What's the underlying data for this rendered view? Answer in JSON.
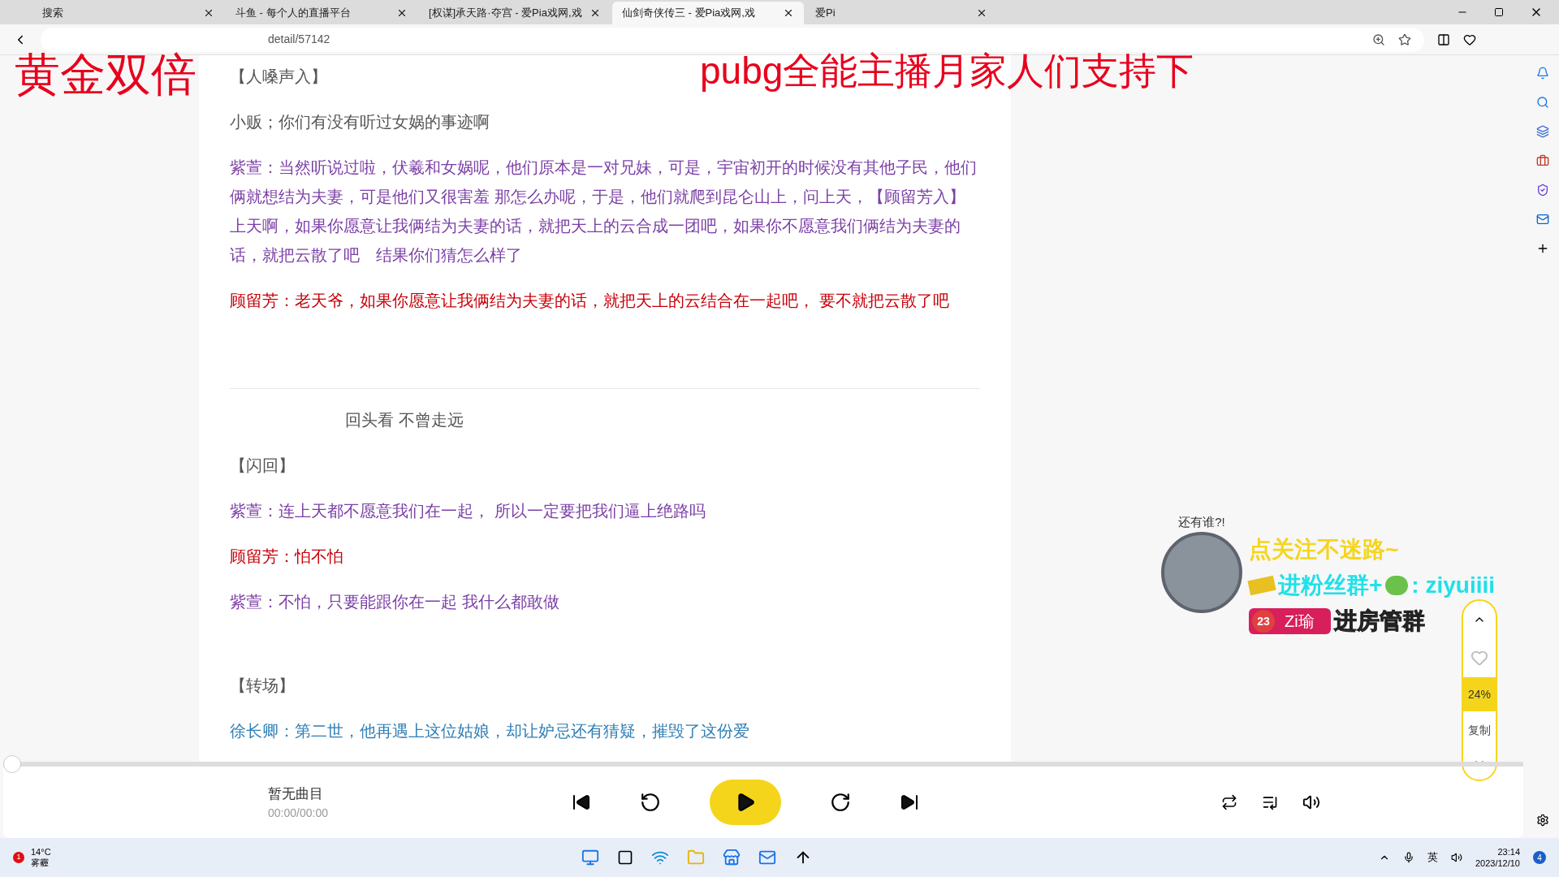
{
  "browser": {
    "tabs": [
      {
        "title": "搜索",
        "selected": false
      },
      {
        "title": "斗鱼 - 每个人的直播平台",
        "selected": false
      },
      {
        "title": "[权谋]承天路·夺宫 - 爱Pia戏网,戏",
        "selected": false
      },
      {
        "title": "仙剑奇侠传三 - 爱Pia戏网,戏",
        "selected": true
      },
      {
        "title": "爱Pi",
        "selected": false
      }
    ],
    "address": "detail/57142"
  },
  "script": {
    "blocks": [
      {
        "kind": "line",
        "text": "【人嗓声入】",
        "color": "#555555"
      },
      {
        "kind": "line",
        "text": "小贩；你们有没有听过女娲的事迹啊",
        "color": "#555555"
      },
      {
        "kind": "line",
        "text": "紫萱：当然听说过啦，伏羲和女娲呢，他们原本是一对兄妹，可是，宇宙初开的时候没有其他子民，他们俩就想结为夫妻，可是他们又很害羞 那怎么办呢，于是，他们就爬到昆仑山上，问上天，【顾留芳入】上天啊，如果你愿意让我俩结为夫妻的话，就把天上的云合成一团吧，如果你不愿意我们俩结为夫妻的话，就把云散了吧　结果你们猜怎么样了",
        "color": "#7b3fa6"
      },
      {
        "kind": "line",
        "text": "顾留芳：老天爷，如果你愿意让我俩结为夫妻的话，就把天上的云结合在一起吧， 要不就把云散了吧",
        "color": "#c8000a"
      },
      {
        "kind": "divider"
      },
      {
        "kind": "heading",
        "text": "回头看 不曾走远",
        "color": "#555555"
      },
      {
        "kind": "line",
        "text": "【闪回】",
        "color": "#555555"
      },
      {
        "kind": "line",
        "text": "紫萱：连上天都不愿意我们在一起， 所以一定要把我们逼上绝路吗",
        "color": "#7b3fa6"
      },
      {
        "kind": "line",
        "text": "顾留芳：怕不怕",
        "color": "#c8000a"
      },
      {
        "kind": "line",
        "text": "紫萱：不怕，只要能跟你在一起 我什么都敢做",
        "color": "#7b3fa6"
      },
      {
        "kind": "gap"
      },
      {
        "kind": "line",
        "text": "【转场】",
        "color": "#555555"
      },
      {
        "kind": "line",
        "text": "徐长卿：第二世，他再遇上这位姑娘，却让妒忌还有猜疑，摧毁了这份爱",
        "color": "#2f7fb5"
      }
    ]
  },
  "widget": {
    "percent": "24%",
    "copy": "复制"
  },
  "player": {
    "progress": {
      "level": 0
    },
    "title": "暂无曲目",
    "time": "00:00/00:00"
  },
  "overlay": {
    "left_banner": "黄金双倍",
    "top_banner": "pubg全能主播月家人们支持下",
    "bubble": "还有谁?!",
    "follow": "点关注不迷路~",
    "group": "进粉丝群+",
    "wechat": ": ziyuiiii",
    "badge_level": "23",
    "badge_name": "Zi瑜",
    "manager": "进房管群"
  },
  "taskbar": {
    "weather": {
      "badge": "1",
      "temp": "14°C",
      "desc": "雾霾"
    },
    "ime": "英",
    "time": "23:14",
    "date": "2023/12/10",
    "notifications": "4"
  }
}
